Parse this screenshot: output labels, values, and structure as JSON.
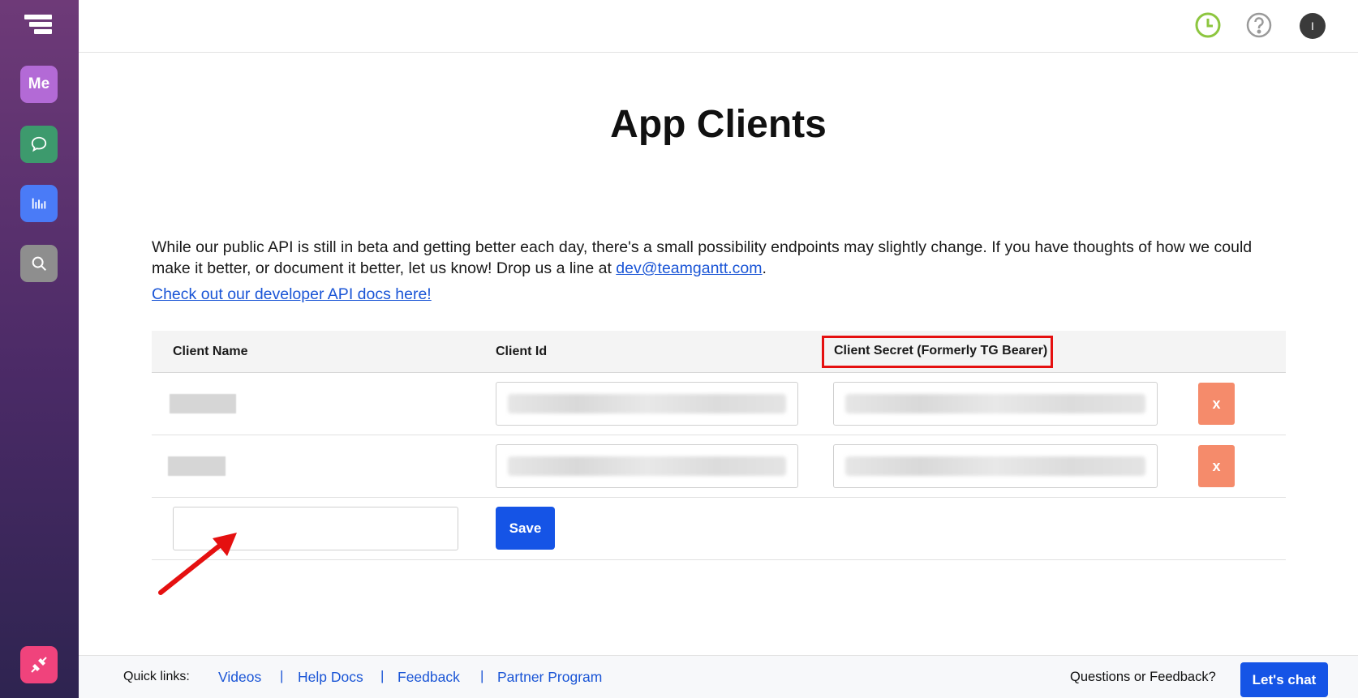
{
  "sidebar": {
    "me_label": "Me",
    "icons": [
      "logo-icon",
      "chat-icon",
      "reports-icon",
      "search-icon",
      "integrations-icon"
    ]
  },
  "topbar": {
    "avatar_initial": "I",
    "icons": [
      "clock-icon",
      "help-icon"
    ],
    "clock_color": "#8dc63f"
  },
  "main": {
    "title": "App Clients",
    "intro_text": "While our public API is still in beta and getting better each day, there's a small possibility endpoints may slightly change. If you have thoughts of how we could make it better, or document it better, let us know! Drop us a line at ",
    "intro_email": "dev@teamgantt.com",
    "intro_end": ".",
    "docs_link": "Check out our developer API docs here!"
  },
  "table": {
    "headers": [
      "Client Name",
      "Client Id",
      "Client Secret (Formerly TG Bearer)"
    ],
    "delete_label": "x",
    "save_label": "Save"
  },
  "footer": {
    "quick_links_label": "Quick links:",
    "links": [
      "Videos",
      "Help Docs",
      "Feedback",
      "Partner Program"
    ],
    "separator": "|",
    "questions_label": "Questions or Feedback?",
    "chat_label": "Let's chat"
  },
  "colors": {
    "primary": "#1554e6",
    "delete": "#f58b6b",
    "highlight": "#e51010"
  }
}
